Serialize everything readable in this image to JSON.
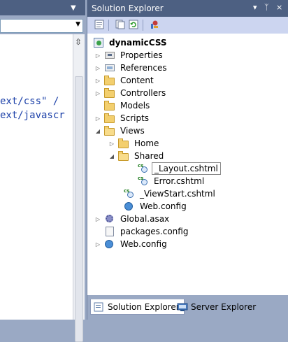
{
  "editor": {
    "code_lines": [
      "ext/css\" /",
      "ext/javascr"
    ],
    "title_menu_glyph": "▼"
  },
  "panel": {
    "title": "Solution Explorer",
    "title_buttons": [
      "▾",
      "ᛉ",
      "×"
    ],
    "toolbar_icons": [
      "properties-icon",
      "show-all-files-icon",
      "refresh-icon",
      "class-diagram-icon"
    ]
  },
  "tree": {
    "items": [
      {
        "label": "dynamicCSS",
        "icon": "project-icon",
        "expander": "",
        "bold": true
      },
      {
        "label": "Properties",
        "icon": "properties-icon",
        "expander": "▷"
      },
      {
        "label": "References",
        "icon": "references-icon",
        "expander": "▷"
      },
      {
        "label": "Content",
        "icon": "folder-icon",
        "expander": "▷"
      },
      {
        "label": "Controllers",
        "icon": "folder-icon",
        "expander": "▷"
      },
      {
        "label": "Models",
        "icon": "folder-icon",
        "expander": ""
      },
      {
        "label": "Scripts",
        "icon": "folder-icon",
        "expander": "▷"
      },
      {
        "label": "Views",
        "icon": "folder-open-icon",
        "expander": "◢"
      },
      {
        "label": "Home",
        "icon": "folder-icon",
        "expander": "▷"
      },
      {
        "label": "Shared",
        "icon": "folder-open-icon",
        "expander": "◢"
      },
      {
        "label": "_Layout.cshtml",
        "icon": "cshtml-file-icon",
        "expander": "",
        "selected": true
      },
      {
        "label": "Error.cshtml",
        "icon": "cshtml-file-icon",
        "expander": ""
      },
      {
        "label": "_ViewStart.cshtml",
        "icon": "cshtml-file-icon",
        "expander": ""
      },
      {
        "label": "Web.config",
        "icon": "web-config-icon",
        "expander": ""
      },
      {
        "label": "Global.asax",
        "icon": "global-asax-icon",
        "expander": "▷"
      },
      {
        "label": "packages.config",
        "icon": "config-file-icon",
        "expander": ""
      },
      {
        "label": "Web.config",
        "icon": "web-config-icon",
        "expander": "▷"
      }
    ]
  },
  "tabs": {
    "solution_explorer": "Solution Explorer",
    "server_explorer": "Server Explorer"
  },
  "colors": {
    "title_bar": "#4d6082",
    "toolbar": "#ccd5f0",
    "background": "#9aa9c4",
    "code_text": "#1a3fa8"
  }
}
